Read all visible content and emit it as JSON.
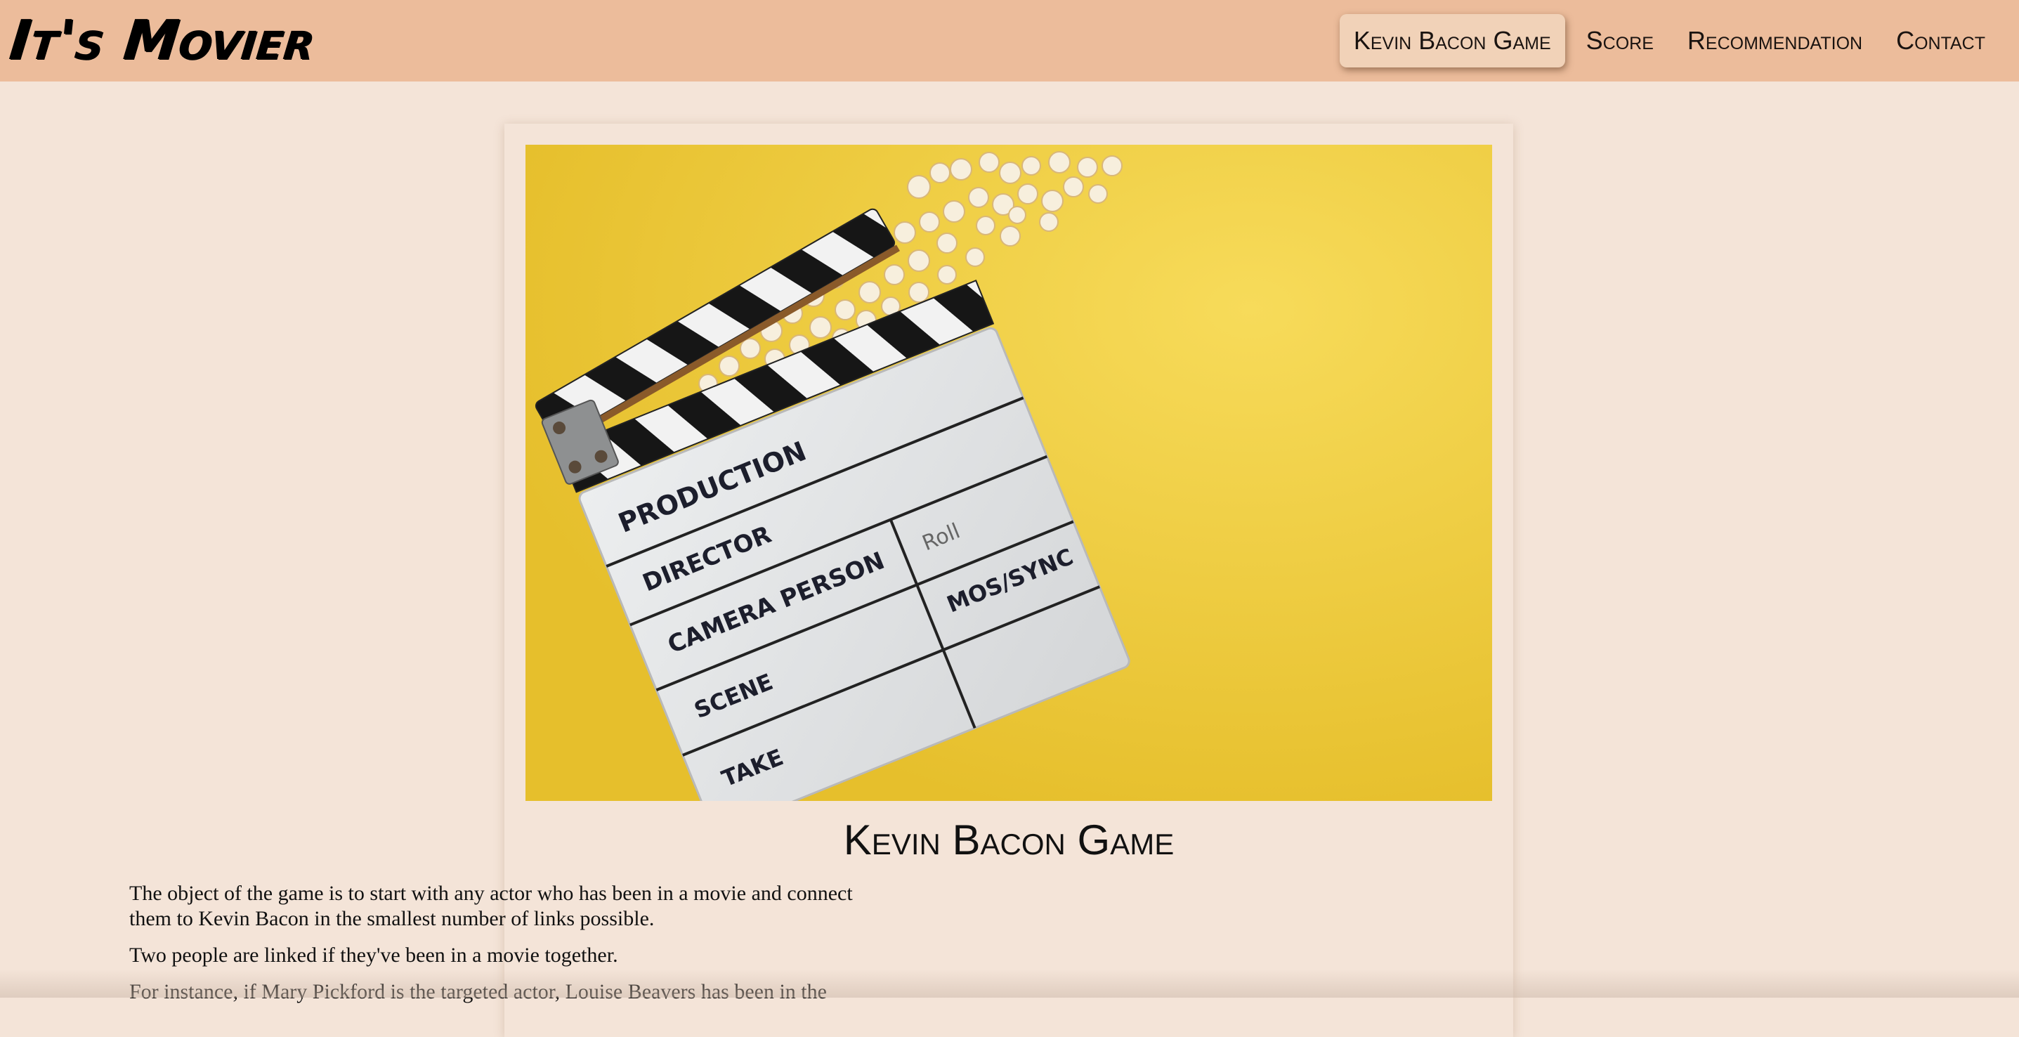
{
  "brand": {
    "title": "It's Movier"
  },
  "nav": {
    "items": [
      {
        "label": "Kevin Bacon Game",
        "active": true
      },
      {
        "label": "Score",
        "active": false
      },
      {
        "label": "Recommendation",
        "active": false
      },
      {
        "label": "Contact",
        "active": false
      }
    ]
  },
  "hero": {
    "slate": {
      "production": "PRODUCTION",
      "director": "DIRECTOR",
      "camera_person": "CAMERA PERSON",
      "roll": "Roll",
      "scene": "SCENE",
      "mos_sync": "MOS/SYNC",
      "take": "TAKE"
    }
  },
  "main": {
    "title": "Kevin Bacon Game",
    "paragraphs": [
      "The object of the game is to start with any actor who has been in a movie and connect them to Kevin Bacon in the smallest number of links possible.",
      "Two people are linked if they've been in a movie together.",
      "For instance, if Mary Pickford is the targeted actor, Louise Beavers has been in the"
    ]
  },
  "colors": {
    "page_bg": "#f4e4d8",
    "navbar_bg": "#ecbc9b",
    "active_tab_bg": "#f1d2b8",
    "hero_yellow": "#f2cc3c"
  }
}
